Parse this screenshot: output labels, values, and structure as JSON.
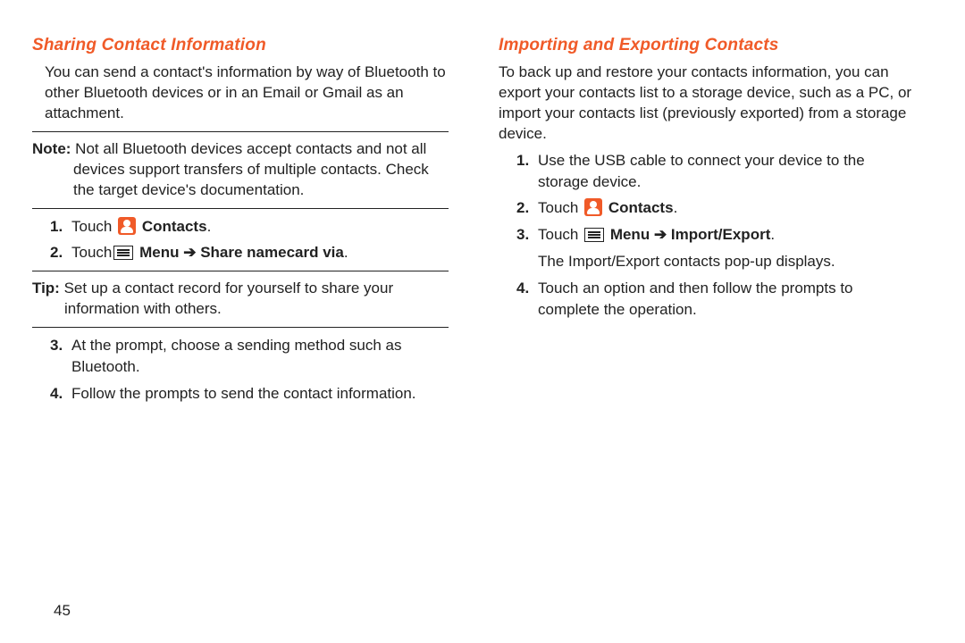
{
  "page_number": "45",
  "left": {
    "heading": "Sharing Contact Information",
    "intro": "You can send a contact's information by way of Bluetooth to other Bluetooth devices or in an Email or Gmail as an attachment.",
    "note_label": "Note:",
    "note_text_line1": " Not all Bluetooth devices accept contacts and not all",
    "note_text_cont": "devices support transfers of multiple contacts. Check the target device's documentation.",
    "step1_num": "1.",
    "step1_pre": "Touch ",
    "step1_bold": " Contacts",
    "step1_post": ".",
    "step2_num": "2.",
    "step2_pre": "Touch",
    "step2_menu": " Menu ",
    "step2_arrow": "➔",
    "step2_bold": " Share namecard via",
    "step2_post": ".",
    "tip_label": "Tip:",
    "tip_text_line1": " Set up a contact record for yourself to share your",
    "tip_text_cont": "information with others.",
    "step3_num": "3.",
    "step3_text": "At the prompt, choose a sending method such as Bluetooth.",
    "step4_num": "4.",
    "step4_text": "Follow the prompts to send the contact information."
  },
  "right": {
    "heading": "Importing and Exporting Contacts",
    "intro": "To back up and restore your contacts information, you can export your contacts list to a storage device, such as a PC, or import your contacts list (previously exported) from a storage device.",
    "step1_num": "1.",
    "step1_text": "Use the USB cable to connect your device to the storage device.",
    "step2_num": "2.",
    "step2_pre": "Touch ",
    "step2_bold": " Contacts",
    "step2_post": ".",
    "step3_num": "3.",
    "step3_pre": "Touch ",
    "step3_menu": " Menu ",
    "step3_arrow": "➔",
    "step3_bold": " Import/Export",
    "step3_post": ".",
    "step3_after": "The Import/Export contacts pop-up displays.",
    "step4_num": "4.",
    "step4_text": "Touch an option and then follow the prompts to complete the operation."
  }
}
